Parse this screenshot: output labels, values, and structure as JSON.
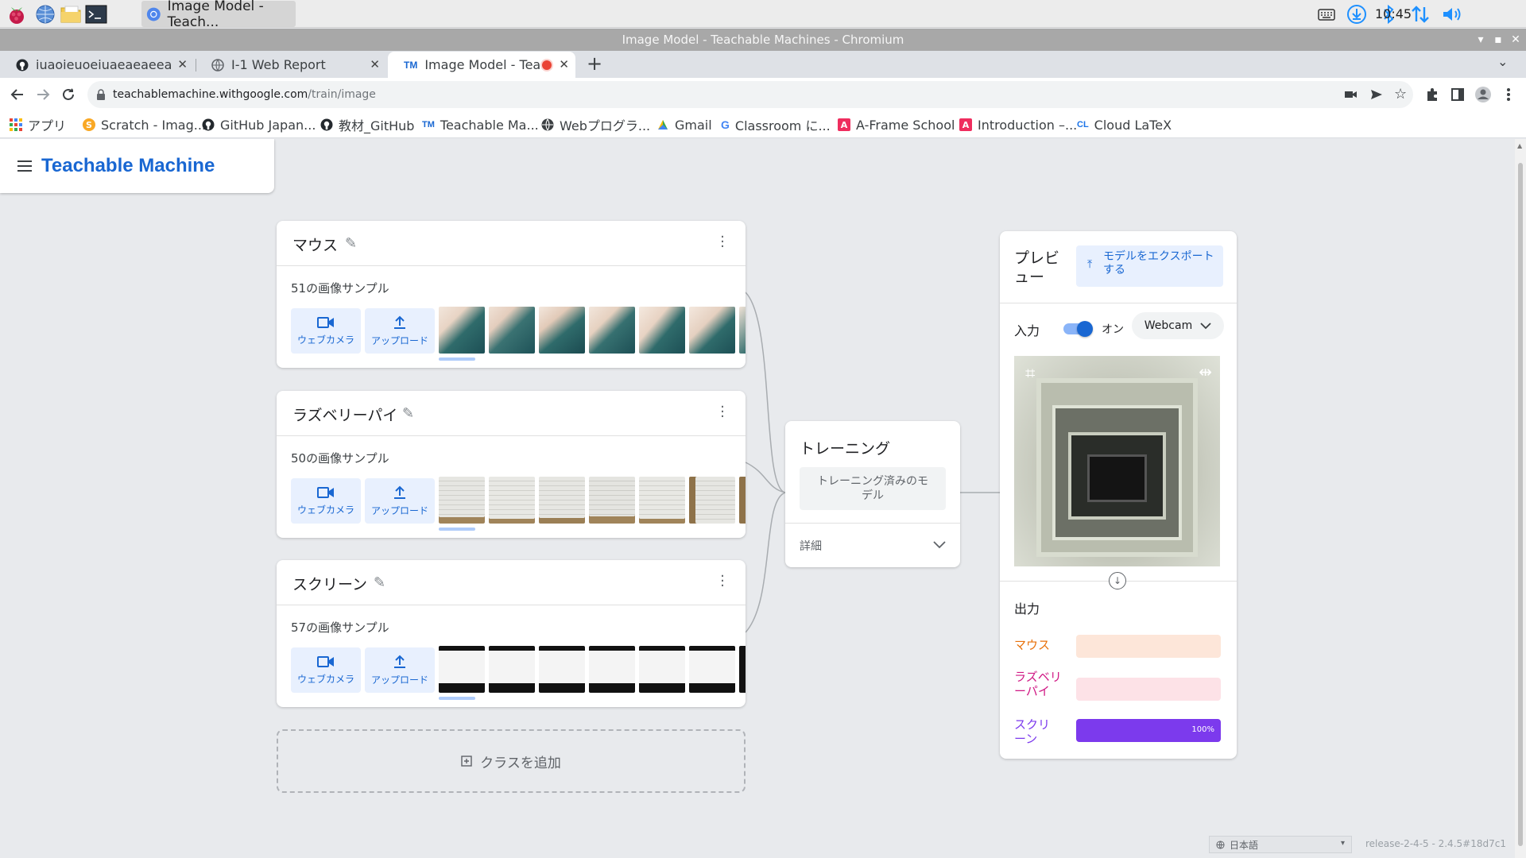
{
  "taskbar": {
    "active_task": "Image Model - Teach...",
    "clock": "10:45"
  },
  "window": {
    "title": "Image Model - Teachable Machines - Chromium"
  },
  "tabs": [
    {
      "label": "iuaoieuoeiuaeaeaeeauoi"
    },
    {
      "label": "I-1 Web Report"
    },
    {
      "label": "Image Model - Teach"
    }
  ],
  "address_bar": {
    "domain": "teachablemachine.withgoogle.com",
    "path": "/train/image"
  },
  "bookmarks": [
    {
      "label": "アプリ",
      "icon": "apps-grid-icon",
      "color": "#ea4335"
    },
    {
      "label": "Scratch - Imag...",
      "icon": "scratch-icon",
      "color": "#f9a825"
    },
    {
      "label": "GitHub Japan...",
      "icon": "github-icon",
      "color": "#24292e"
    },
    {
      "label": "教材_GitHub",
      "icon": "github-icon",
      "color": "#24292e"
    },
    {
      "label": "Teachable Ma...",
      "icon": "teachable-machine-icon",
      "color": "#1967d2"
    },
    {
      "label": "Webプログラ...",
      "icon": "globe-icon",
      "color": "#3c4043"
    },
    {
      "label": "Gmail",
      "icon": "gmail-icon",
      "color": "#ea4335"
    },
    {
      "label": "Classroom に...",
      "icon": "google-icon",
      "color": "#4285f4"
    },
    {
      "label": "A-Frame School",
      "icon": "aframe-icon",
      "color": "#ef2d5e"
    },
    {
      "label": "Introduction –...",
      "icon": "aframe-icon",
      "color": "#ef2d5e"
    },
    {
      "label": "Cloud LaTeX",
      "icon": "cloud-latex-icon",
      "color": "#1a73e8"
    }
  ],
  "app": {
    "title": "Teachable Machine"
  },
  "classes": [
    {
      "name": "マウス",
      "samples": "51の画像サンプル",
      "webcam": "ウェブカメラ",
      "upload": "アップロード"
    },
    {
      "name": "ラズベリーパイ",
      "samples": "50の画像サンプル",
      "webcam": "ウェブカメラ",
      "upload": "アップロード"
    },
    {
      "name": "スクリーン",
      "samples": "57の画像サンプル",
      "webcam": "ウェブカメラ",
      "upload": "アップロード"
    }
  ],
  "add_class": "クラスを追加",
  "training": {
    "title": "トレーニング",
    "button": "トレーニング済みのモデル",
    "details": "詳細"
  },
  "preview": {
    "title": "プレビュー",
    "export": "モデルをエクスポートする",
    "input_label": "入力",
    "toggle_state": "オン",
    "source": "Webcam",
    "output_label": "出力",
    "outputs": [
      {
        "name": "マウス",
        "percent": 0,
        "color": "#e8710a",
        "track": "#fde6d9"
      },
      {
        "name": "ラズベリーパイ",
        "percent": 0,
        "color": "#d01884",
        "track": "#fde2e7"
      },
      {
        "name": "スクリーン",
        "percent": 100,
        "label": "100%",
        "color": "#7c3aed",
        "track": "#e9ddff"
      }
    ]
  },
  "footer": {
    "language": "日本語",
    "version": "release-2-4-5 - 2.4.5#18d7c1"
  }
}
